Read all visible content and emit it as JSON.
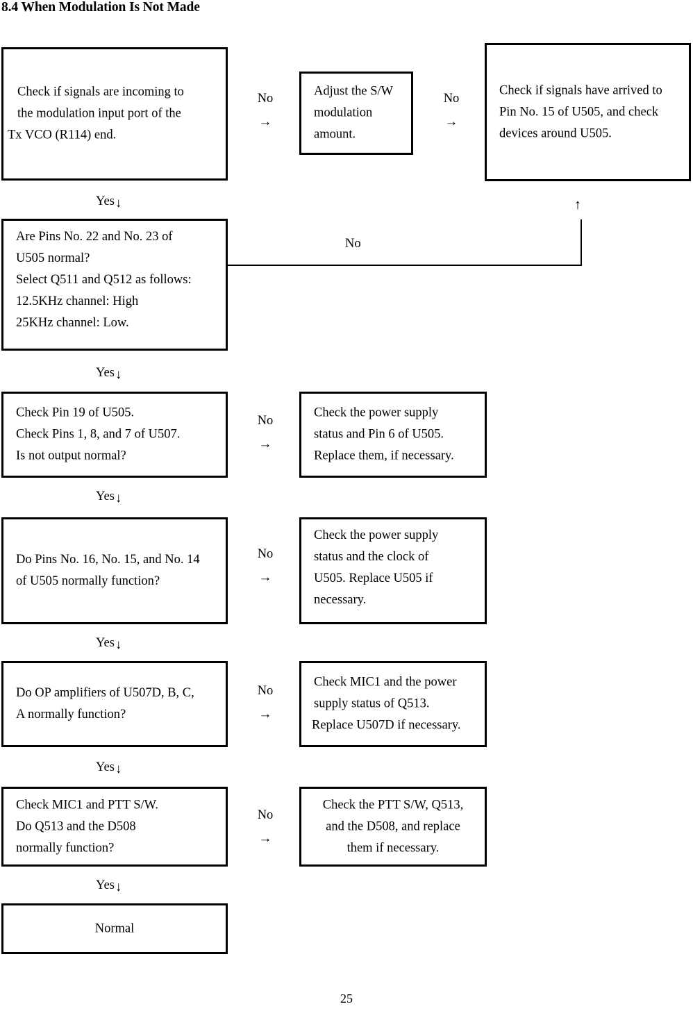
{
  "document": {
    "section_title": "8.4 When Modulation Is Not Made",
    "page_number": "25"
  },
  "flowchart": {
    "boxes": {
      "b1_check_tx_vco": {
        "lines": [
          "Check if signals are incoming to",
          "the modulation input port of the",
          "Tx VCO (R114) end."
        ]
      },
      "b1_adjust_sw": {
        "lines": [
          "Adjust the S/W",
          "modulation",
          "amount."
        ]
      },
      "b1_check_pin15": {
        "lines": [
          "Check if signals have arrived to",
          "Pin No. 15 of U505, and check",
          "devices around U505."
        ]
      },
      "b2_pins_22_23": {
        "lines": [
          "Are Pins No. 22 and No. 23 of",
          "U505 normal?",
          "Select Q511 and Q512 as follows:",
          "12.5KHz channel: High",
          "25KHz channel: Low."
        ]
      },
      "b3_check_pin19": {
        "lines": [
          "Check Pin 19 of U505.",
          "Check Pins 1, 8, and 7 of U507.",
          "Is not output normal?"
        ]
      },
      "b3_power_pin6": {
        "lines": [
          "Check the power supply",
          "status and Pin 6 of U505.",
          "Replace them, if necessary."
        ]
      },
      "b4_pins_16_15_14": {
        "lines": [
          "Do Pins No. 16, No. 15, and No. 14",
          "of U505 normally function?"
        ]
      },
      "b4_power_clock": {
        "lines": [
          "Check the power supply",
          "status and the clock of",
          "U505. Replace U505 if",
          "necessary."
        ]
      },
      "b5_op_amps": {
        "lines": [
          "Do OP amplifiers of U507D, B, C,",
          "A normally function?"
        ]
      },
      "b5_mic1_q513": {
        "lines": [
          "Check MIC1 and the power",
          "supply status of Q513.",
          "Replace U507D if necessary."
        ]
      },
      "b6_mic1_ptt": {
        "lines": [
          "Check MIC1 and PTT S/W.",
          "Do Q513 and the D508",
          "normally function?"
        ]
      },
      "b6_ptt_q513_d508": {
        "lines": [
          "Check the PTT S/W, Q513,",
          "and the D508, and replace",
          "them if necessary."
        ]
      },
      "b7_normal": {
        "lines": [
          "Normal"
        ]
      }
    },
    "connectors": {
      "yes_text": "Yes",
      "yes_arrow": "↓",
      "no_text": "No",
      "no_arrow": "→",
      "loop_arrow_up": "↑"
    }
  }
}
